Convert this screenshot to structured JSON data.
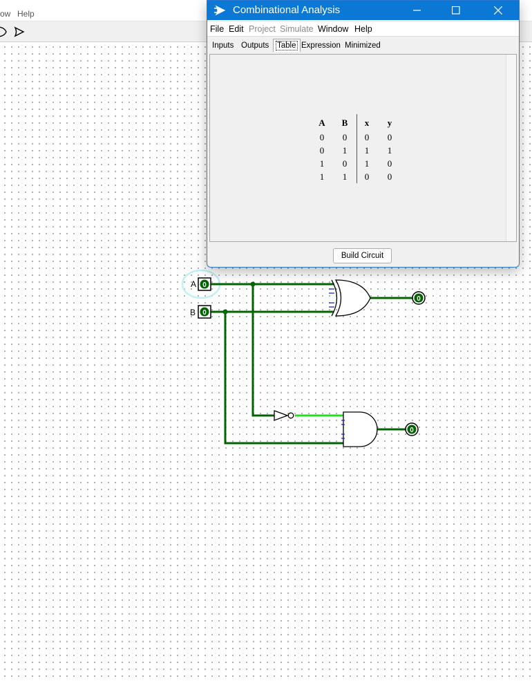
{
  "main_window": {
    "menu": [
      "ow",
      "Help"
    ]
  },
  "circuit": {
    "pins": [
      {
        "label": "A",
        "value": "0"
      },
      {
        "label": "B",
        "value": "0"
      }
    ],
    "outputs": [
      {
        "value": "0"
      },
      {
        "value": "0"
      }
    ]
  },
  "dialog": {
    "title": "Combinational Analysis",
    "menu": [
      "File",
      "Edit",
      "Project",
      "Simulate",
      "Window",
      "Help"
    ],
    "disabled_menu": [
      "Project",
      "Simulate"
    ],
    "tabs": [
      "Inputs",
      "Outputs",
      "Table",
      "Expression",
      "Minimized"
    ],
    "active_tab": "Table",
    "table": {
      "columns": [
        "A",
        "B",
        "x",
        "y"
      ],
      "rows": [
        [
          "0",
          "0",
          "0",
          "0"
        ],
        [
          "0",
          "1",
          "1",
          "1"
        ],
        [
          "1",
          "0",
          "1",
          "0"
        ],
        [
          "1",
          "1",
          "0",
          "0"
        ]
      ]
    },
    "build_button": "Build Circuit"
  },
  "colors": {
    "wire_dark": "#006400",
    "wire_light": "#22dd22",
    "title_bar": "#0a78d4",
    "selection_halo": "#bff0f4"
  },
  "icons": [
    "or-gate-icon",
    "play-triangle-icon",
    "logisim-icon",
    "minimize-icon",
    "maximize-icon",
    "close-icon"
  ]
}
